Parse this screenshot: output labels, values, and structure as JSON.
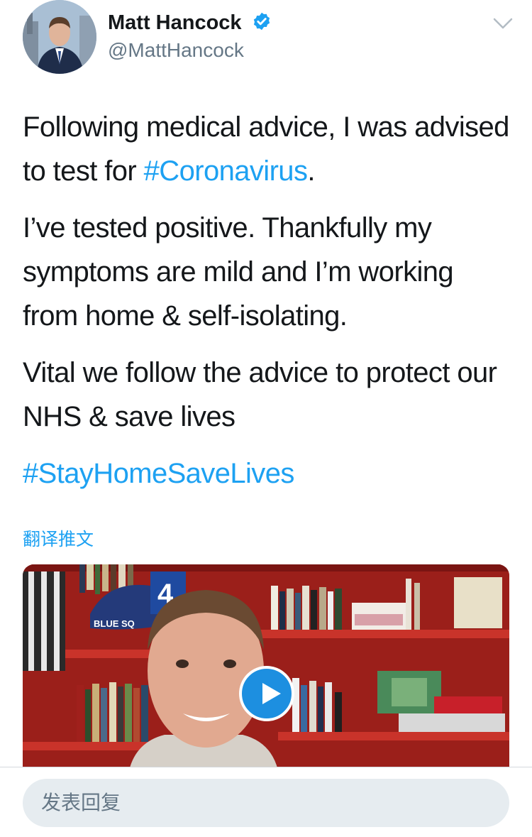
{
  "author": {
    "name": "Matt Hancock",
    "handle": "@MattHancock",
    "verified_icon": "verified-badge-icon"
  },
  "tweet": {
    "p1_before": "Following medical advice, I was advised to test for ",
    "p1_tag": "#Coronavirus",
    "p1_after": ".",
    "p2": "I’ve tested positive. Thankfully my symptoms are mild and I’m working from home & self-isolating.",
    "p3": "Vital we follow the advice to protect our NHS & save lives",
    "p4_tag": "#StayHomeSaveLives"
  },
  "translate_label": "翻译推文",
  "media": {
    "type": "video",
    "play_icon": "play-icon",
    "scene_labels": {
      "cap_text": "BLUE SQ",
      "shirt_number": "4"
    }
  },
  "reply": {
    "placeholder": "发表回复"
  },
  "colors": {
    "accent": "#1da1f2",
    "text": "#14171a",
    "muted": "#657786",
    "reply_bg": "#e6ecf0"
  }
}
